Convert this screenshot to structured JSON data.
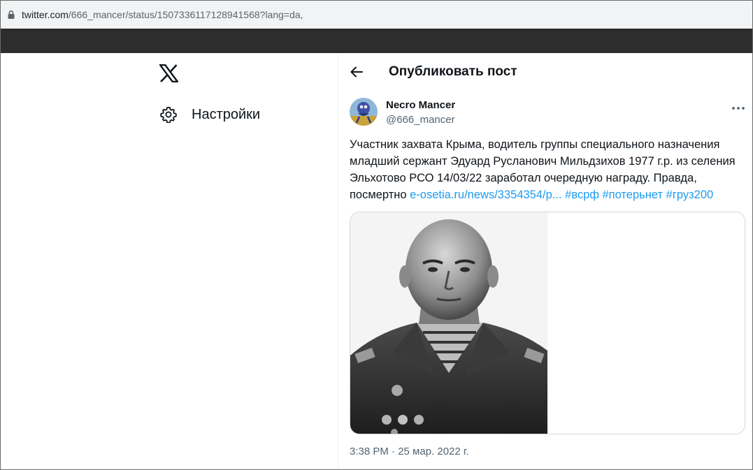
{
  "browser": {
    "url_host": "twitter.com",
    "url_path": "/666_mancer/status/1507336117128941568?lang=da,"
  },
  "sidebar": {
    "logo_icon": "x-logo-icon",
    "settings_label": "Настройки",
    "settings_icon": "gear-icon"
  },
  "header": {
    "title": "Опубликовать пост",
    "back_icon": "arrow-left-icon"
  },
  "post": {
    "author_name": "Necro Mancer",
    "author_handle": "@666_mancer",
    "text_lines": [
      "Участник захвата Крыма, водитель группы специального назначения",
      "младший сержант Эдуард Русланович Мильдзихов 1977 г.р. из селения",
      "Эльхотово РСО 14/03/22 заработал очередную награду. Правда,"
    ],
    "text_last_prefix": "посмертно ",
    "link": "e-osetia.ru/news/3354354/р...",
    "hashtags": [
      "#всрф",
      "#потерьнет",
      "#груз200"
    ],
    "timestamp": "3:38 PM · 25 мар. 2022 г.",
    "more_icon": "ellipsis-icon"
  },
  "colors": {
    "link": "#1d9bf0",
    "text": "#0f1419",
    "secondary": "#536471"
  }
}
